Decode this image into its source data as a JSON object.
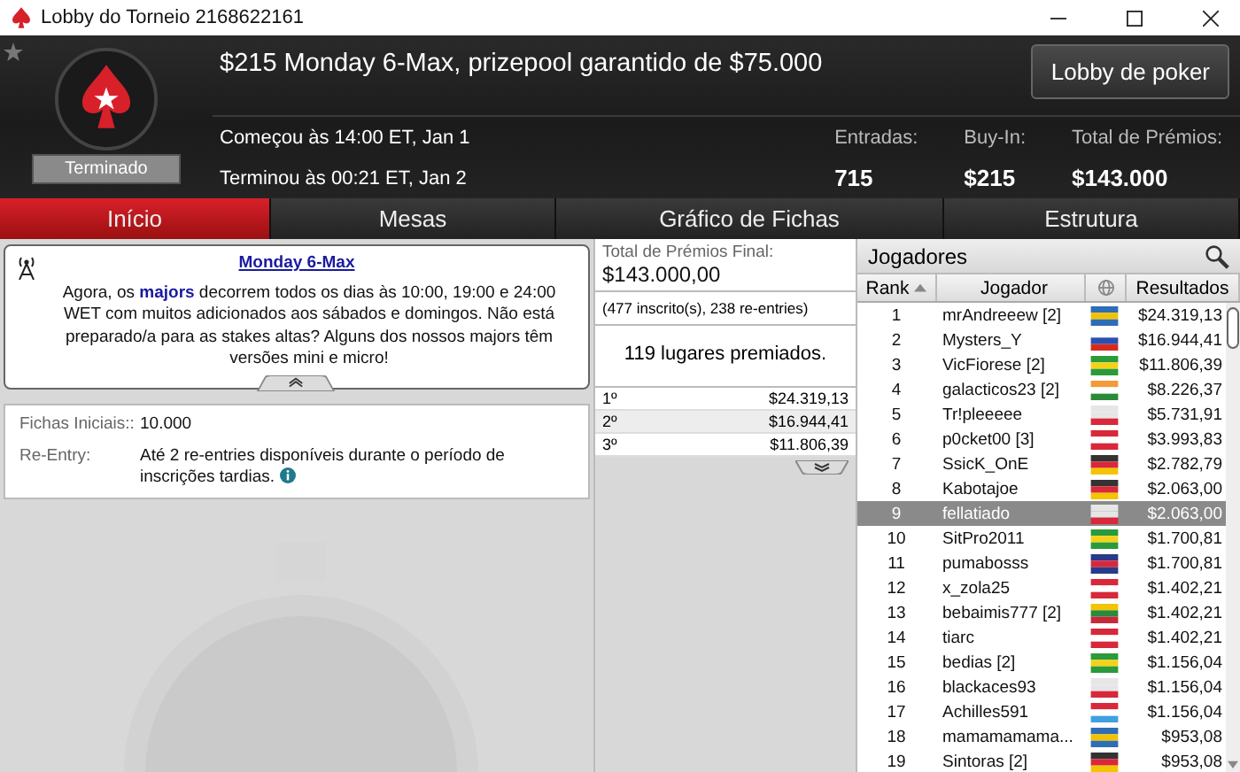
{
  "window": {
    "title": "Lobby do Torneio 2168622161"
  },
  "header": {
    "title": "$215 Monday 6-Max, prizepool garantido de $75.000",
    "status": "Terminado",
    "lobby_button": "Lobby de poker",
    "times": [
      "Começou às 14:00 ET, Jan 1",
      "Terminou às 00:21 ET, Jan 2"
    ],
    "stats": [
      {
        "label": "Entradas:",
        "value": "715"
      },
      {
        "label": "Buy-In:",
        "value": "$215"
      },
      {
        "label": "Total de Prémios:",
        "value": "$143.000"
      }
    ]
  },
  "tabs": [
    {
      "label": "Início",
      "selected": true
    },
    {
      "label": "Mesas",
      "selected": false
    },
    {
      "label": "Gráfico de Fichas",
      "selected": false
    },
    {
      "label": "Estrutura",
      "selected": false
    }
  ],
  "news": {
    "title": "Monday 6-Max",
    "text": "Agora, os **majors** decorrem todos os dias às 10:00, 19:00 e 24:00 WET com muitos adicionados aos sábados e domingos. Não está preparado/a para as stakes altas? Alguns dos nossos majors têm versões mini e micro!"
  },
  "details": [
    {
      "label": "Fichas Iniciais::",
      "value": "10.000"
    },
    {
      "label": "Re-Entry:",
      "value": "Até 2 re-entries disponíveis durante o período de inscrições tardias."
    }
  ],
  "prizes": {
    "label": "Total de Prémios Final:",
    "total": "$143.000,00",
    "entrants": "(477 inscrito(s), 238 re-entries)",
    "paid": "119 lugares premiados.",
    "rows": [
      {
        "place": "1º",
        "amount": "$24.319,13"
      },
      {
        "place": "2º",
        "amount": "$16.944,41"
      },
      {
        "place": "3º",
        "amount": "$11.806,39"
      }
    ]
  },
  "players": {
    "title": "Jogadores",
    "columns": [
      "Rank",
      "Jogador",
      "Resultados"
    ],
    "rows": [
      {
        "rank": "1",
        "name": "mrAndreeew [2]",
        "flag": [
          {
            "color": "#2f6db5"
          },
          {
            "color": "#f2c200"
          },
          {
            "color": "#2f6db5"
          }
        ],
        "result": "$24.319,13",
        "selected": false
      },
      {
        "rank": "2",
        "name": "Mysters_Y",
        "flag": [
          {
            "color": "#ffffff"
          },
          {
            "color": "#2850b0"
          },
          {
            "color": "#d52b1e"
          }
        ],
        "result": "$16.944,41",
        "selected": false
      },
      {
        "rank": "3",
        "name": "VicFiorese [2]",
        "flag": [
          {
            "color": "#2a9a3a"
          },
          {
            "color": "#f4d21a"
          },
          {
            "color": "#2a9a3a"
          }
        ],
        "result": "$11.806,39",
        "selected": false
      },
      {
        "rank": "4",
        "name": "galacticos23 [2]",
        "flag": [
          {
            "color": "#f39a3a"
          },
          {
            "color": "#ffffff"
          },
          {
            "color": "#2a8a3a"
          }
        ],
        "result": "$8.226,37",
        "selected": false
      },
      {
        "rank": "5",
        "name": "Tr!pleeeee",
        "flag": [
          {
            "color": "#e6e6e6"
          },
          {
            "color": "#e6e6e6"
          },
          {
            "color": "#d8283a"
          }
        ],
        "result": "$5.731,91",
        "selected": false
      },
      {
        "rank": "6",
        "name": "p0cket00 [3]",
        "flag": [
          {
            "color": "#d8283a"
          },
          {
            "color": "#ffffff"
          },
          {
            "color": "#d8283a"
          }
        ],
        "result": "$3.993,83",
        "selected": false
      },
      {
        "rank": "7",
        "name": "SsicK_OnE",
        "flag": [
          {
            "color": "#333333"
          },
          {
            "color": "#d8283a"
          },
          {
            "color": "#f4c400"
          }
        ],
        "result": "$2.782,79",
        "selected": false
      },
      {
        "rank": "8",
        "name": "Kabotajoe",
        "flag": [
          {
            "color": "#333333"
          },
          {
            "color": "#d8283a"
          },
          {
            "color": "#f4c400"
          }
        ],
        "result": "$2.063,00",
        "selected": false
      },
      {
        "rank": "9",
        "name": "fellatiado",
        "flag": [
          {
            "color": "#e6e6e6"
          },
          {
            "color": "#e6e6e6"
          },
          {
            "color": "#d8283a"
          }
        ],
        "result": "$2.063,00",
        "selected": true
      },
      {
        "rank": "10",
        "name": "SitPro2011",
        "flag": [
          {
            "color": "#2a9a3a"
          },
          {
            "color": "#f4d21a"
          },
          {
            "color": "#2a9a3a"
          }
        ],
        "result": "$1.700,81",
        "selected": false
      },
      {
        "rank": "11",
        "name": "pumabosss",
        "flag": [
          {
            "color": "#2a3a8a"
          },
          {
            "color": "#d8283a"
          },
          {
            "color": "#2a3a8a"
          }
        ],
        "result": "$1.700,81",
        "selected": false
      },
      {
        "rank": "12",
        "name": "x_zola25",
        "flag": [
          {
            "color": "#d8283a"
          },
          {
            "color": "#ffffff"
          },
          {
            "color": "#d8283a"
          }
        ],
        "result": "$1.402,21",
        "selected": false
      },
      {
        "rank": "13",
        "name": "bebaimis777 [2]",
        "flag": [
          {
            "color": "#f4c400"
          },
          {
            "color": "#2a8a3a"
          },
          {
            "color": "#c8283a"
          }
        ],
        "result": "$1.402,21",
        "selected": false
      },
      {
        "rank": "14",
        "name": "tiarc",
        "flag": [
          {
            "color": "#d8283a"
          },
          {
            "color": "#ffffff"
          },
          {
            "color": "#d8283a"
          }
        ],
        "result": "$1.402,21",
        "selected": false
      },
      {
        "rank": "15",
        "name": "bedias [2]",
        "flag": [
          {
            "color": "#2a9a3a"
          },
          {
            "color": "#f4d21a"
          },
          {
            "color": "#2a9a3a"
          }
        ],
        "result": "$1.156,04",
        "selected": false
      },
      {
        "rank": "16",
        "name": "blackaces93",
        "flag": [
          {
            "color": "#e6e6e6"
          },
          {
            "color": "#e6e6e6"
          },
          {
            "color": "#d8283a"
          }
        ],
        "result": "$1.156,04",
        "selected": false
      },
      {
        "rank": "17",
        "name": "Achilles591",
        "flag": [
          {
            "color": "#d8283a"
          },
          {
            "color": "#ffffff"
          },
          {
            "color": "#40a0e0"
          }
        ],
        "result": "$1.156,04",
        "selected": false
      },
      {
        "rank": "18",
        "name": "mamamamama...",
        "flag": [
          {
            "color": "#2f6db5"
          },
          {
            "color": "#f2c200"
          },
          {
            "color": "#2f6db5"
          }
        ],
        "result": "$953,08",
        "selected": false
      },
      {
        "rank": "19",
        "name": "Sintoras [2]",
        "flag": [
          {
            "color": "#333333"
          },
          {
            "color": "#d8283a"
          },
          {
            "color": "#f4c400"
          }
        ],
        "result": "$953,08",
        "selected": false
      }
    ]
  }
}
